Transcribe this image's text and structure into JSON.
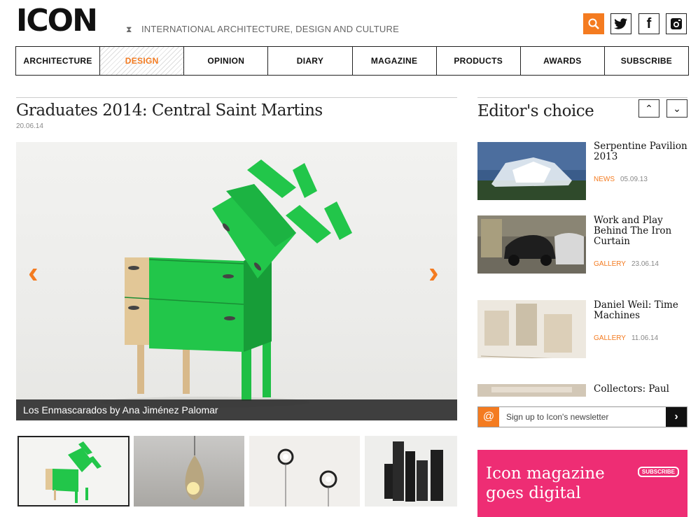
{
  "header": {
    "logo": "ICON",
    "tagline": "INTERNATIONAL ARCHITECTURE, DESIGN AND CULTURE",
    "social": [
      {
        "icon": "search-icon",
        "glyph": "⚲"
      },
      {
        "icon": "twitter-icon",
        "glyph": "🐦"
      },
      {
        "icon": "facebook-icon",
        "glyph": "f"
      },
      {
        "icon": "instagram-icon",
        "glyph": "◙"
      }
    ],
    "accent_color": "#f47b20"
  },
  "nav": {
    "items": [
      "ARCHITECTURE",
      "DESIGN",
      "OPINION",
      "DIARY",
      "MAGAZINE",
      "PRODUCTS",
      "AWARDS",
      "SUBSCRIBE"
    ],
    "active": "DESIGN"
  },
  "article": {
    "title": "Graduates 2014: Central Saint Martins",
    "date": "20.06.14",
    "caption": "Los Enmascarados by Ana Jiménez Palomar",
    "prev_glyph": "‹",
    "next_glyph": "›"
  },
  "editors_choice": {
    "title": "Editor's choice",
    "up_glyph": "⌃",
    "down_glyph": "⌄",
    "items": [
      {
        "title": "Serpentine Pavilion 2013",
        "category": "NEWS",
        "date": "05.09.13"
      },
      {
        "title": "Work and Play Behind The Iron Curtain",
        "category": "GALLERY",
        "date": "23.06.14"
      },
      {
        "title": "Daniel Weil: Time Machines",
        "category": "GALLERY",
        "date": "11.06.14"
      },
      {
        "title": "Collectors: Paul",
        "category": "",
        "date": ""
      }
    ]
  },
  "newsletter": {
    "at": "@",
    "text": "Sign up to Icon's newsletter",
    "go": "›"
  },
  "promo": {
    "line1": "Icon magazine",
    "line2": "goes digital",
    "button": "SUBSCRIBE",
    "color": "#ee2d74"
  }
}
